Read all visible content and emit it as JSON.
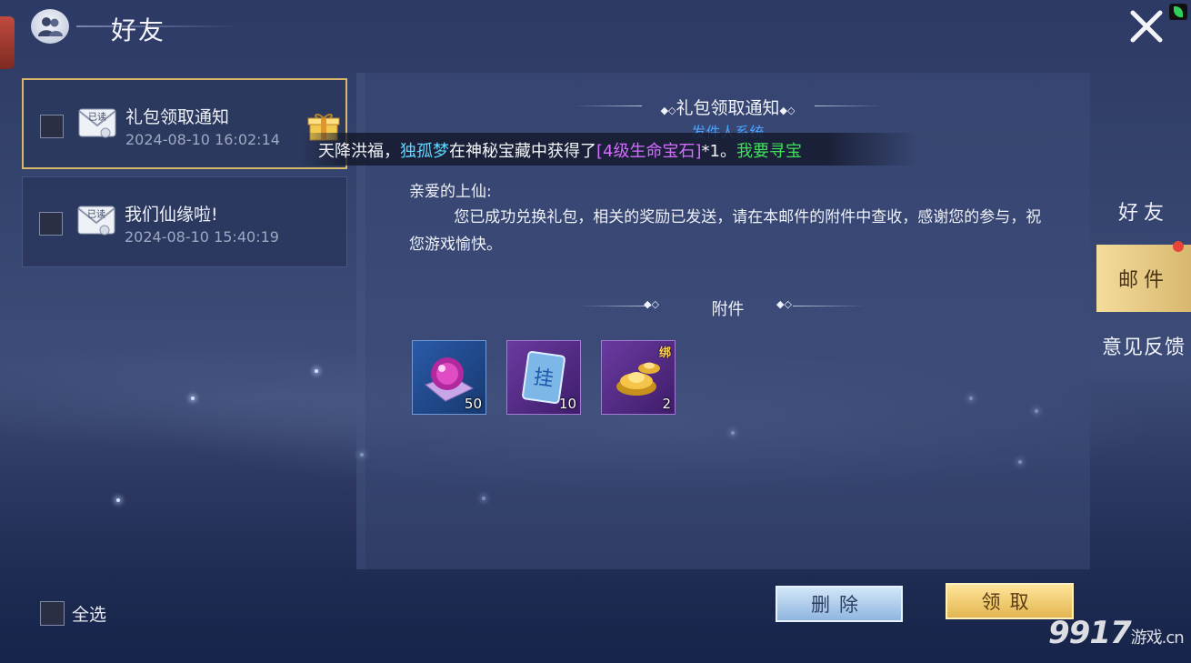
{
  "header": {
    "title": "好友"
  },
  "mails": [
    {
      "title": "礼包领取通知",
      "date": "2024-08-10 16:02:14",
      "read_stamp": "已读"
    },
    {
      "title": "我们仙缘啦!",
      "date": "2024-08-10 15:40:19",
      "read_stamp": "已读"
    }
  ],
  "select_all_label": "全选",
  "content": {
    "title": "礼包领取通知",
    "sender": "发件人系统",
    "greeting": "亲爱的上仙:",
    "body": "您已成功兑换礼包，相关的奖励已发送，请在本邮件的附件中查收，感谢您的参与，祝您游戏愉快。",
    "attachment_title": "附件",
    "attachments": [
      {
        "icon": "purple-orb-icon",
        "count": "50",
        "rarity": "blue"
      },
      {
        "icon": "talisman-card-icon",
        "count": "10",
        "rarity": "purple",
        "glyph": "挂"
      },
      {
        "icon": "gold-ingot-icon",
        "count": "2",
        "rarity": "purple",
        "bind_label": "绑"
      }
    ]
  },
  "broadcast": {
    "prefix": "天降洪福，",
    "player": "独孤梦",
    "middle": "在神秘宝藏中获得了",
    "item": "[4级生命宝石]",
    "suffix": "*1。",
    "link": "我要寻宝"
  },
  "buttons": {
    "delete": "删除",
    "claim": "领取"
  },
  "tabs": [
    {
      "label": "好友",
      "active": false
    },
    {
      "label": "邮件",
      "active": true,
      "has_notice": true
    },
    {
      "label": "意见反馈",
      "active": false
    }
  ],
  "watermark": {
    "number": "9917",
    "site": "游戏",
    "domain": ".cn"
  },
  "colors": {
    "accent_gold": "#d8b76a",
    "sender_blue": "#4aa3ff",
    "player_cyan": "#5fd6ff",
    "item_purple": "#d56cff",
    "link_green": "#3fe05a"
  }
}
